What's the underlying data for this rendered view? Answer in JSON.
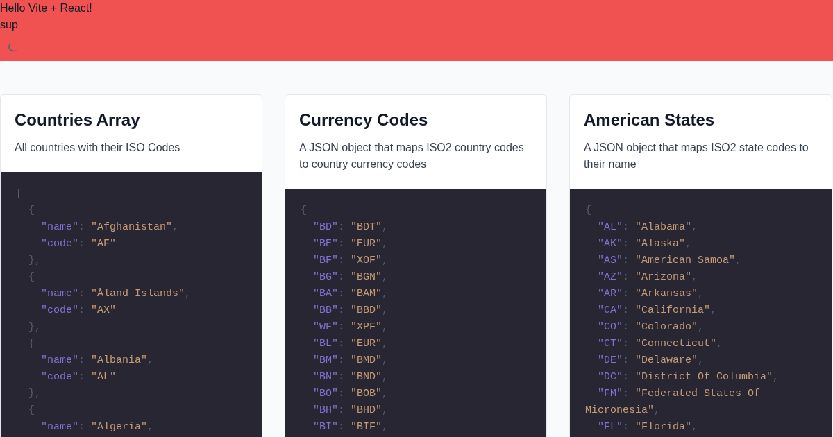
{
  "header": {
    "title": "Hello Vite + React!",
    "subtitle": "sup"
  },
  "cards": [
    {
      "title": "Countries Array",
      "description": "All countries with their ISO Codes",
      "code": [
        "[",
        "  {",
        "    \"name\": \"Afghanistan\",",
        "    \"code\": \"AF\"",
        "  },",
        "  {",
        "    \"name\": \"Åland Islands\",",
        "    \"code\": \"AX\"",
        "  },",
        "  {",
        "    \"name\": \"Albania\",",
        "    \"code\": \"AL\"",
        "  },",
        "  {",
        "    \"name\": \"Algeria\","
      ]
    },
    {
      "title": "Currency Codes",
      "description": "A JSON object that maps ISO2 country codes to country currency codes",
      "code": [
        "{",
        "  \"BD\": \"BDT\",",
        "  \"BE\": \"EUR\",",
        "  \"BF\": \"XOF\",",
        "  \"BG\": \"BGN\",",
        "  \"BA\": \"BAM\",",
        "  \"BB\": \"BBD\",",
        "  \"WF\": \"XPF\",",
        "  \"BL\": \"EUR\",",
        "  \"BM\": \"BMD\",",
        "  \"BN\": \"BND\",",
        "  \"BO\": \"BOB\",",
        "  \"BH\": \"BHD\",",
        "  \"BI\": \"BIF\","
      ]
    },
    {
      "title": "American States",
      "description": "A JSON object that maps ISO2 state codes to their name",
      "code": [
        "{",
        "  \"AL\": \"Alabama\",",
        "  \"AK\": \"Alaska\",",
        "  \"AS\": \"American Samoa\",",
        "  \"AZ\": \"Arizona\",",
        "  \"AR\": \"Arkansas\",",
        "  \"CA\": \"California\",",
        "  \"CO\": \"Colorado\",",
        "  \"CT\": \"Connecticut\",",
        "  \"DE\": \"Delaware\",",
        "  \"DC\": \"District Of Columbia\",",
        "  \"FM\": \"Federated States Of Micronesia\",",
        "  \"FL\": \"Florida\","
      ]
    }
  ]
}
